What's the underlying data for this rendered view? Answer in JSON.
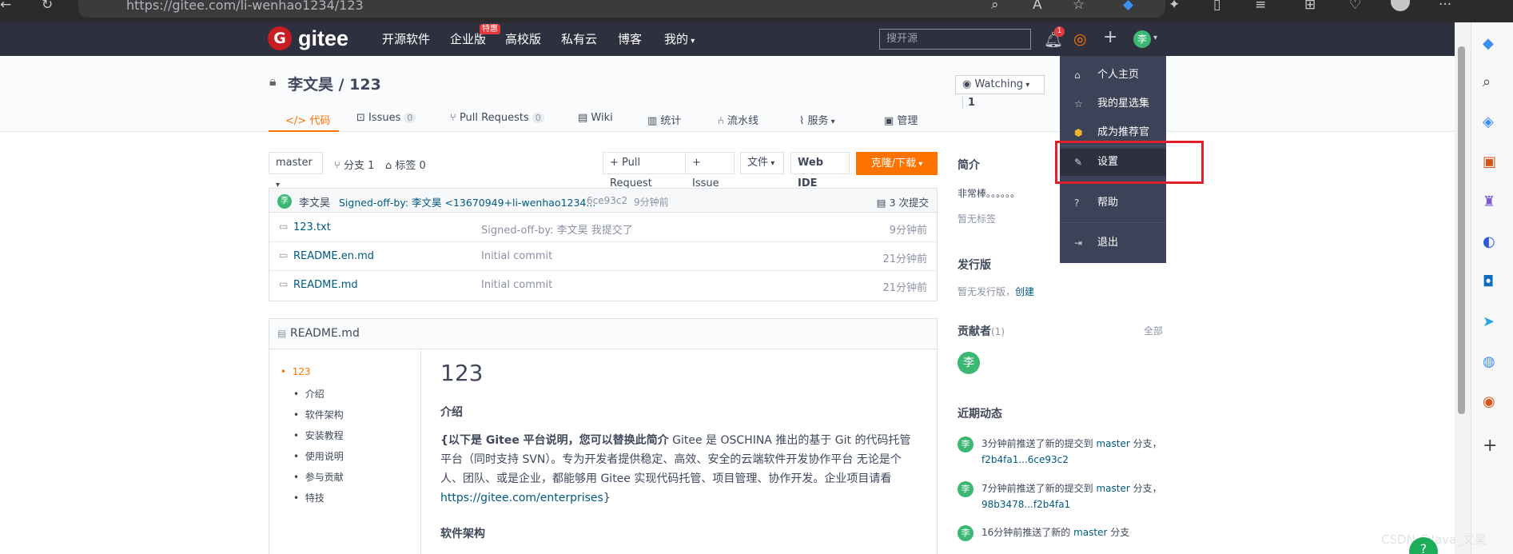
{
  "browser": {
    "url": "https://gitee.com/li-wenhao1234/123"
  },
  "header": {
    "logo_letter": "G",
    "logo_text": "gitee",
    "nav": [
      "开源软件",
      "企业版",
      "高校版",
      "私有云",
      "博客",
      "我的"
    ],
    "hot_badge": "特惠",
    "search_placeholder": "搜开源",
    "bell_count": "1",
    "avatar": "李"
  },
  "repo": {
    "title": "李文昊 / 123",
    "watch_label": "Watching",
    "watch_count": "1",
    "tabs": [
      {
        "label": "代码",
        "count": ""
      },
      {
        "label": "Issues",
        "count": "0"
      },
      {
        "label": "Pull Requests",
        "count": "0"
      },
      {
        "label": "Wiki",
        "count": ""
      },
      {
        "label": "统计",
        "count": ""
      },
      {
        "label": "流水线",
        "count": ""
      },
      {
        "label": "服务",
        "count": ""
      },
      {
        "label": "管理",
        "count": ""
      }
    ]
  },
  "toolbar": {
    "branch": "master",
    "branches": "分支 1",
    "tags": "标签 0",
    "pull_request": "+ Pull Request",
    "issue": "+ Issue",
    "file": "文件",
    "web_ide": "Web IDE",
    "clone": "克隆/下载"
  },
  "commit": {
    "author": "李文昊",
    "message": "Signed-off-by: 李文昊 <13670949+li-wenhao1234...",
    "hash": "6ce93c2",
    "time": "9分钟前",
    "total": "3 次提交"
  },
  "files": [
    {
      "name": "123.txt",
      "message": "Signed-off-by: 李文昊 我提交了",
      "time": "9分钟前"
    },
    {
      "name": "README.en.md",
      "message": "Initial commit",
      "time": "21分钟前"
    },
    {
      "name": "README.md",
      "message": "Initial commit",
      "time": "21分钟前"
    }
  ],
  "readme": {
    "filename": "README.md",
    "toc": [
      "123",
      "介绍",
      "软件架构",
      "安装教程",
      "使用说明",
      "参与贡献",
      "特技"
    ],
    "title": "123",
    "h_intro": "介绍",
    "intro_bold": "{以下是 Gitee 平台说明，您可以替换此简介",
    "intro_text": " Gitee 是 OSCHINA 推出的基于 Git 的代码托管平台（同时支持 SVN）。专为开发者提供稳定、高效、安全的云端软件开发协作平台 无论是个人、团队、或是企业，都能够用 Gitee 实现代码托管、项目管理、协作开发。企业项目请看 ",
    "intro_link": "https://gitee.com/enterprises",
    "intro_end": "}",
    "h_arch": "软件架构"
  },
  "sidebar": {
    "intro_title": "简介",
    "intro_text": "非常棒。。。。。。",
    "no_tags": "暂无标签",
    "release_title": "发行版",
    "release_text": "暂无发行版，",
    "release_link": "创建",
    "contrib_title": "贡献者",
    "contrib_count": "(1)",
    "contrib_all": "全部",
    "activity_title": "近期动态",
    "activities": [
      {
        "text": "3分钟前推送了新的提交到 ",
        "branch": "master",
        "tail": " 分支，",
        "range": "f2b4fa1...6ce93c2"
      },
      {
        "text": "7分钟前推送了新的提交到 ",
        "branch": "master",
        "tail": " 分支，",
        "range": "98b3478...f2b4fa1"
      },
      {
        "text": "16分钟前推送了新的 ",
        "branch": "master",
        "tail": " 分支",
        "range": ""
      }
    ]
  },
  "dropdown": {
    "items": [
      "个人主页",
      "我的星选集",
      "成为推荐官",
      "设置",
      "帮助",
      "退出"
    ]
  },
  "watermark": "CSDN @Java_文昊",
  "help_bubble": "?"
}
